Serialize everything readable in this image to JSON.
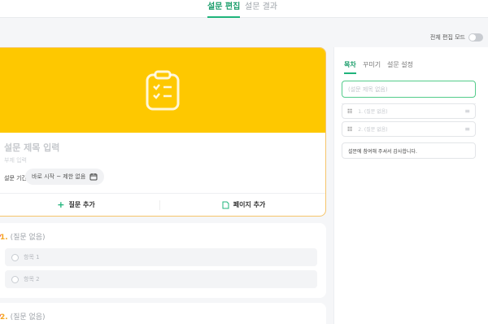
{
  "nav": {
    "tab_edit": "설문 편집",
    "tab_result": "설문 결과"
  },
  "fullmode": {
    "label": "전체 편집 모드",
    "enabled": false
  },
  "survey": {
    "title_placeholder": "설문 제목 입력",
    "subtitle_placeholder": "부제 입력",
    "period_label": "설문 기간",
    "period_value": "바로 시작 ~ 제한 없음",
    "add_question": "질문 추가",
    "add_page": "페이지 추가",
    "banner_color": "#fec800"
  },
  "questions": [
    {
      "number": "1.",
      "title": "(질문 없음)",
      "options": [
        "항목 1",
        "항목 2"
      ]
    },
    {
      "number": "2.",
      "title": "(질문 없음)"
    }
  ],
  "sidebar": {
    "tabs": [
      "목차",
      "꾸미기",
      "설문 설정"
    ],
    "title_input_placeholder": "(설문 제목 없음)",
    "items": [
      "1. (질문 없음)",
      "2. (질문 없음)"
    ],
    "end_message": "설문에 참여해 주셔서 감사합니다."
  },
  "colors": {
    "accent": "#1fb47b",
    "question_number": "#f5a623"
  }
}
